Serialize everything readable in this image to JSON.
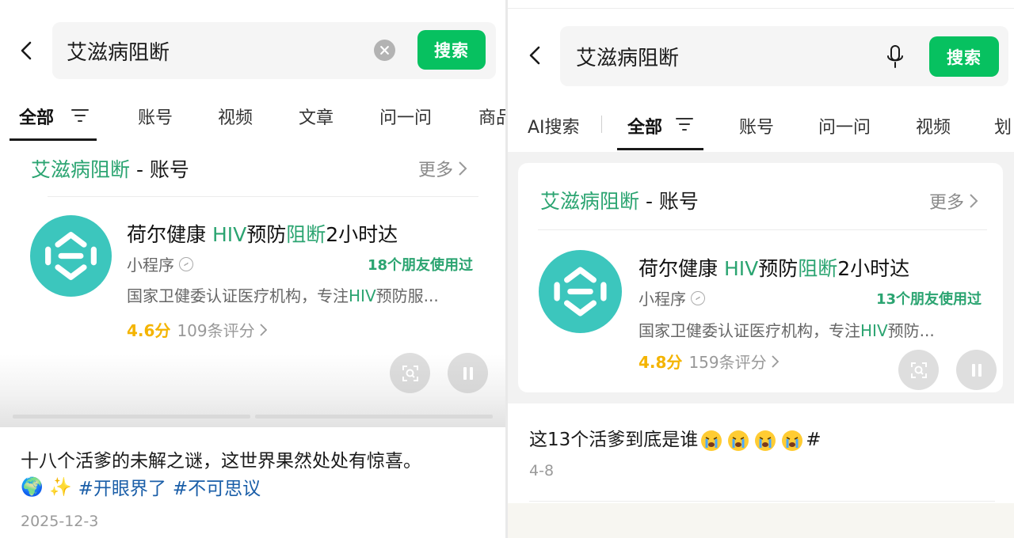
{
  "left": {
    "search": {
      "query": "艾滋病阻断",
      "button": "搜索"
    },
    "tabs": [
      {
        "label": "全部",
        "active": true
      },
      {
        "label": "账号"
      },
      {
        "label": "视频"
      },
      {
        "label": "文章"
      },
      {
        "label": "问一问"
      },
      {
        "label": "商品"
      }
    ],
    "section": {
      "keyword": "艾滋病阻断",
      "suffix": " - 账号",
      "more": "更多"
    },
    "result": {
      "name_parts": [
        "荷尔健康 ",
        "HIV",
        "预防",
        "阻断",
        "2小时达"
      ],
      "type": "小程序",
      "friends": "18个朋友使用过",
      "desc_parts": [
        "国家卫健委认证医疗机构，专注",
        "HIV",
        "预防服..."
      ],
      "score": "4.6分",
      "reviews": "109条评分"
    },
    "post": {
      "caption": "十八个活爹的未解之谜，这世界果然处处有惊喜。",
      "emojis": "🌍 ✨",
      "tags": [
        "#开眼界了",
        "#不可思议"
      ],
      "date": "2025-12-3"
    }
  },
  "right": {
    "search": {
      "query": "艾滋病阻断",
      "button": "搜索"
    },
    "tabs": [
      {
        "label": "AI搜索"
      },
      {
        "label": "全部",
        "active": true
      },
      {
        "label": "账号"
      },
      {
        "label": "问一问"
      },
      {
        "label": "视频"
      },
      {
        "label": "划"
      }
    ],
    "section": {
      "keyword": "艾滋病阻断",
      "suffix": " - 账号",
      "more": "更多"
    },
    "result": {
      "name_parts": [
        "荷尔健康 ",
        "HIV",
        "预防",
        "阻断",
        "2小时达"
      ],
      "type": "小程序",
      "friends": "13个朋友使用过",
      "desc_parts": [
        "国家卫健委认证医疗机构，专注",
        "HIV",
        "预防..."
      ],
      "score": "4.8分",
      "reviews": "159条评分"
    },
    "post": {
      "caption": "这13个活爹到底是谁",
      "trailing": "#",
      "date": "4-8"
    }
  },
  "colors": {
    "accent_green": "#07c160",
    "highlight_green": "#2ba471",
    "logo_teal": "#3cc6bd",
    "rating_gold": "#f4b400",
    "tag_blue": "#1a5ea8"
  },
  "icons": [
    "back-arrow-icon",
    "clear-icon",
    "microphone-icon",
    "filter-icon",
    "chevron-right-icon",
    "mini-program-icon",
    "scan-icon",
    "pause-icon",
    "globe-emoji",
    "sparkles-emoji",
    "crying-face-emoji"
  ]
}
